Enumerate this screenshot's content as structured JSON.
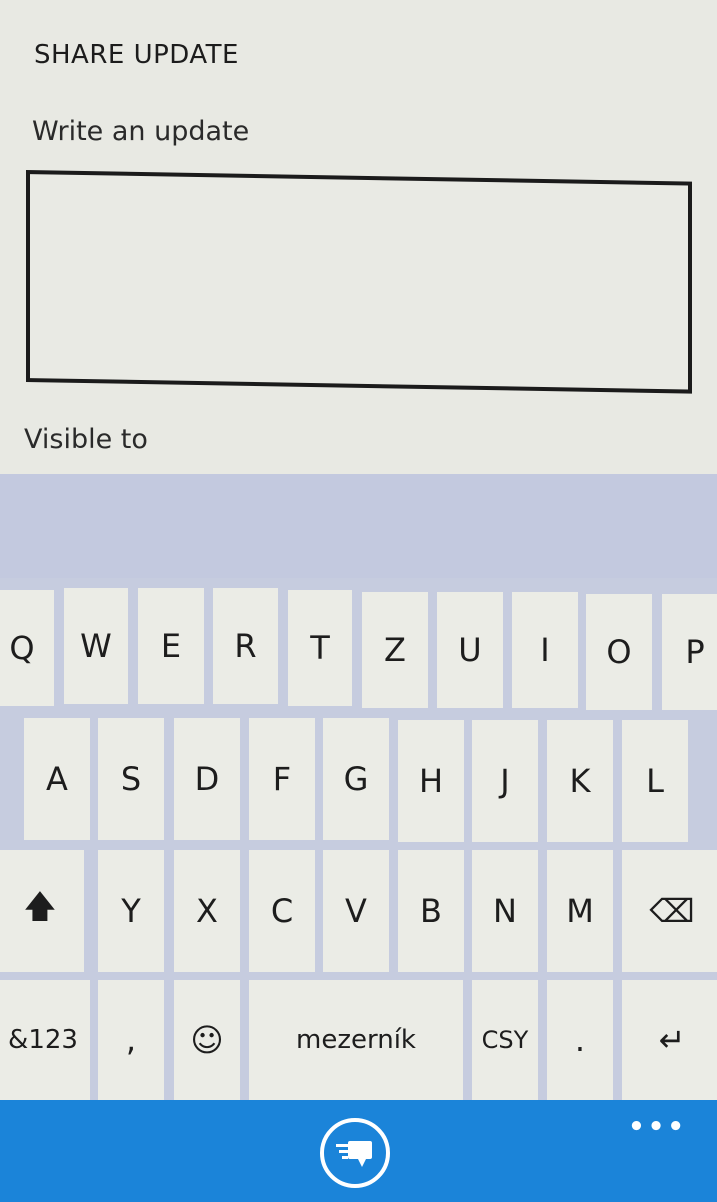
{
  "header": {
    "title": "SHARE UPDATE"
  },
  "update": {
    "label": "Write an update",
    "value": ""
  },
  "visibility": {
    "label": "Visible to"
  },
  "keyboard": {
    "row1": [
      "Q",
      "W",
      "E",
      "R",
      "T",
      "Z",
      "U",
      "I",
      "O",
      "P"
    ],
    "row2": [
      "A",
      "S",
      "D",
      "F",
      "G",
      "H",
      "J",
      "K",
      "L"
    ],
    "row3": [
      "Y",
      "X",
      "C",
      "V",
      "B",
      "N",
      "M"
    ],
    "shift_glyph": "🡅",
    "backspace_glyph": "⌫",
    "numbers_label": "&123",
    "comma": ",",
    "emoji_glyph": "☺",
    "space_label": "mezerník",
    "language_label": "CSY",
    "period": ".",
    "enter_glyph": "↵"
  },
  "appbar": {
    "more": "•••",
    "accent": "#1b84d9"
  }
}
